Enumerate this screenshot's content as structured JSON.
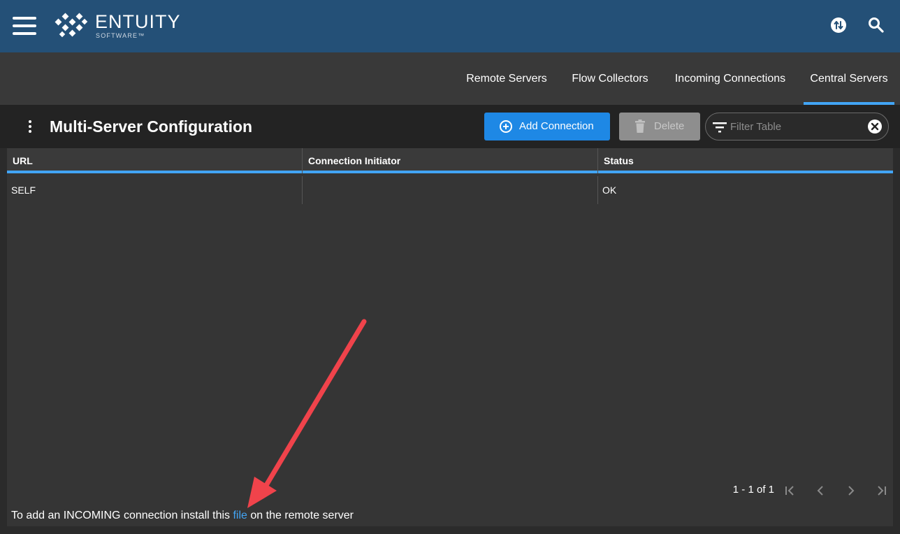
{
  "header": {
    "brand_name": "ENTUITY",
    "brand_sub": "SOFTWARE™"
  },
  "tabs": [
    {
      "label": "Remote Servers"
    },
    {
      "label": "Flow Collectors"
    },
    {
      "label": "Incoming Connections"
    },
    {
      "label": "Central Servers",
      "active": true
    }
  ],
  "panel": {
    "title": "Multi-Server Configuration",
    "add_label": "Add Connection",
    "delete_label": "Delete",
    "filter_placeholder": "Filter Table"
  },
  "table": {
    "columns": [
      "URL",
      "Connection Initiator",
      "Status"
    ],
    "rows": [
      {
        "url": "SELF",
        "initiator": "",
        "status": "OK"
      }
    ]
  },
  "pagination": {
    "text": "1 - 1 of 1"
  },
  "footer": {
    "before": "To add an INCOMING connection install this ",
    "link": "file",
    "after": " on the remote server"
  },
  "colors": {
    "topbar": "#245077",
    "accent": "#42a5f5",
    "primary_button": "#1e88e5",
    "annotation_arrow": "#f0434b"
  }
}
